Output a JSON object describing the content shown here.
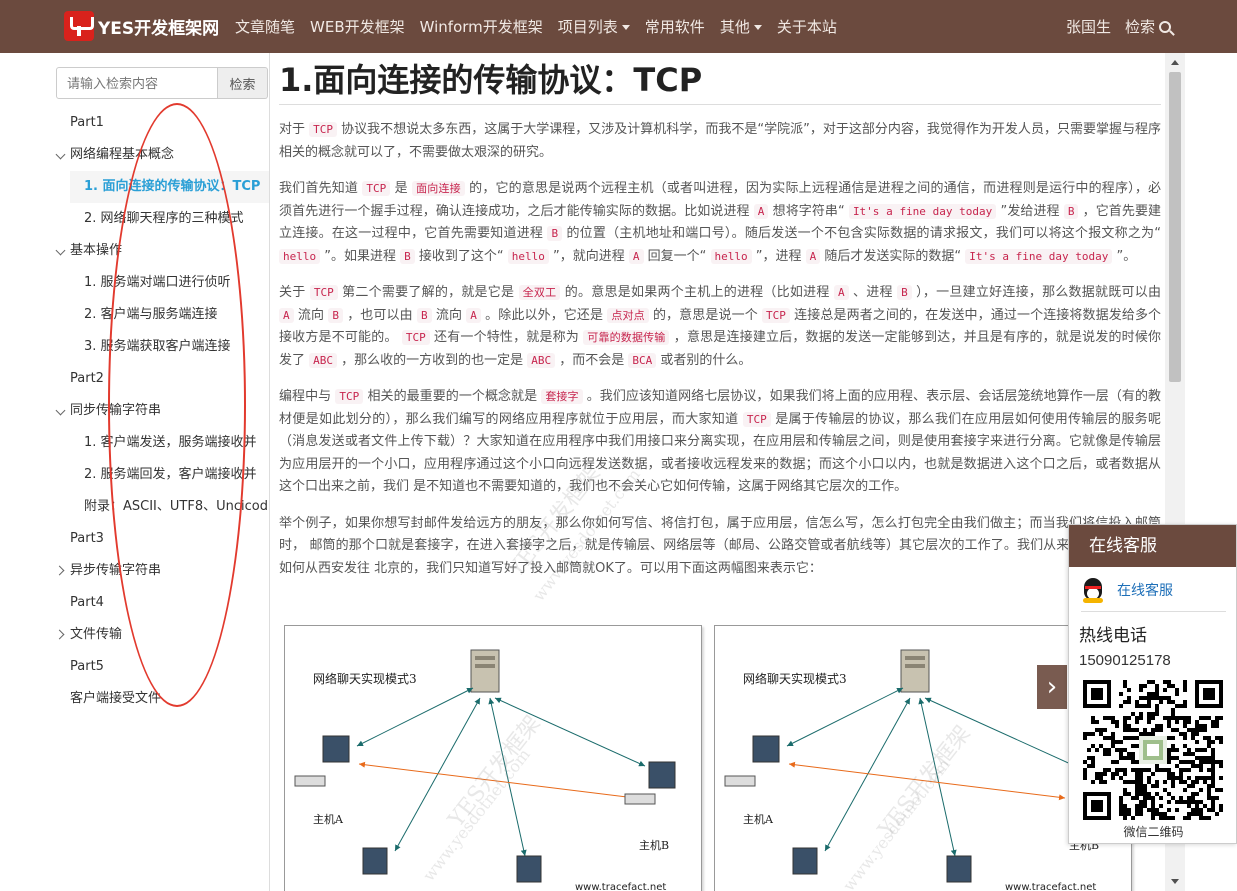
{
  "navbar": {
    "logo_text": "YES开发框架网",
    "items": [
      {
        "label": "文章随笔",
        "dropdown": false
      },
      {
        "label": "WEB开发框架",
        "dropdown": false
      },
      {
        "label": "Winform开发框架",
        "dropdown": false
      },
      {
        "label": "项目列表",
        "dropdown": true
      },
      {
        "label": "常用软件",
        "dropdown": false
      },
      {
        "label": "其他",
        "dropdown": true
      },
      {
        "label": "关于本站",
        "dropdown": false
      }
    ],
    "user": "张国生",
    "search_label": "检索"
  },
  "sidebar": {
    "search_placeholder": "请输入检索内容",
    "search_button": "检索",
    "toc": [
      {
        "label": "Part1",
        "level": 0,
        "toggle": "none"
      },
      {
        "label": "网络编程基本概念",
        "level": 0,
        "toggle": "expanded"
      },
      {
        "label": "1. 面向连接的传输协议：TCP",
        "level": 1,
        "toggle": "none",
        "active": true
      },
      {
        "label": "2. 网络聊天程序的三种模式",
        "level": 1,
        "toggle": "none"
      },
      {
        "label": "基本操作",
        "level": 0,
        "toggle": "expanded"
      },
      {
        "label": "1. 服务端对端口进行侦听",
        "level": 1,
        "toggle": "none"
      },
      {
        "label": "2. 客户端与服务端连接",
        "level": 1,
        "toggle": "none"
      },
      {
        "label": "3. 服务端获取客户端连接",
        "level": 1,
        "toggle": "none"
      },
      {
        "label": "Part2",
        "level": 0,
        "toggle": "none"
      },
      {
        "label": "同步传输字符串",
        "level": 0,
        "toggle": "expanded"
      },
      {
        "label": "1. 客户端发送，服务端接收并",
        "level": 1,
        "toggle": "none"
      },
      {
        "label": "2. 服务端回发，客户端接收并",
        "level": 1,
        "toggle": "none"
      },
      {
        "label": "附录：ASCII、UTF8、Uncicod",
        "level": 1,
        "toggle": "none"
      },
      {
        "label": "Part3",
        "level": 0,
        "toggle": "none"
      },
      {
        "label": "异步传输字符串",
        "level": 0,
        "toggle": "collapsed"
      },
      {
        "label": "Part4",
        "level": 0,
        "toggle": "none"
      },
      {
        "label": "文件传输",
        "level": 0,
        "toggle": "collapsed"
      },
      {
        "label": "Part5",
        "level": 0,
        "toggle": "none"
      },
      {
        "label": "客户端接受文件",
        "level": 0,
        "toggle": "none"
      }
    ]
  },
  "article": {
    "title": "1.面向连接的传输协议：TCP",
    "paragraphs": [
      [
        {
          "t": "对于 "
        },
        {
          "c": "TCP"
        },
        {
          "t": " 协议我不想说太多东西，这属于大学课程，又涉及计算机科学，而我不是“学院派”，对于这部分内容，我觉得作为开发人员，只需要掌握与程序相关的概念就可以了，不需要做太艰深的研究。"
        }
      ],
      [
        {
          "t": "我们首先知道 "
        },
        {
          "c": "TCP"
        },
        {
          "t": " 是 "
        },
        {
          "c": "面向连接"
        },
        {
          "t": " 的，它的意思是说两个远程主机（或者叫进程，因为实际上远程通信是进程之间的通信，而进程则是运行中的程序），必须首先进行一个握手过程，确认连接成功，之后才能传输实际的数据。比如说进程 "
        },
        {
          "c": "A"
        },
        {
          "t": " 想将字符串“ "
        },
        {
          "c": "It's a fine day today"
        },
        {
          "t": " ”发给进程 "
        },
        {
          "c": "B"
        },
        {
          "t": " ，它首先要建立连接。在这一过程中，它首先需要知道进程 "
        },
        {
          "c": "B"
        },
        {
          "t": " 的位置（主机地址和端口号）。随后发送一个不包含实际数据的请求报文，我们可以将这个报文称之为“ "
        },
        {
          "c": "hello"
        },
        {
          "t": " ”。如果进程 "
        },
        {
          "c": "B"
        },
        {
          "t": " 接收到了这个“ "
        },
        {
          "c": "hello"
        },
        {
          "t": " ”，就向进程 "
        },
        {
          "c": "A"
        },
        {
          "t": " 回复一个“ "
        },
        {
          "c": "hello"
        },
        {
          "t": " ”，进程 "
        },
        {
          "c": "A"
        },
        {
          "t": " 随后才发送实际的数据“ "
        },
        {
          "c": "It's a fine day today"
        },
        {
          "t": " ”。"
        }
      ],
      [
        {
          "t": "关于 "
        },
        {
          "c": "TCP"
        },
        {
          "t": " 第二个需要了解的，就是它是 "
        },
        {
          "c": "全双工"
        },
        {
          "t": " 的。意思是如果两个主机上的进程（比如进程 "
        },
        {
          "c": "A"
        },
        {
          "t": " 、进程 "
        },
        {
          "c": "B"
        },
        {
          "t": " ），一旦建立好连接，那么数据就既可以由 "
        },
        {
          "c": "A"
        },
        {
          "t": " 流向 "
        },
        {
          "c": "B"
        },
        {
          "t": " ，也可以由 "
        },
        {
          "c": "B"
        },
        {
          "t": " 流向 "
        },
        {
          "c": "A"
        },
        {
          "t": " 。除此以外，它还是 "
        },
        {
          "c": "点对点"
        },
        {
          "t": " 的，意思是说一个 "
        },
        {
          "c": "TCP"
        },
        {
          "t": " 连接总是两者之间的，在发送中，通过一个连接将数据发给多个接收方是不可能的。 "
        },
        {
          "c": "TCP"
        },
        {
          "t": " 还有一个特性，就是称为 "
        },
        {
          "c": "可靠的数据传输"
        },
        {
          "t": " ，意思是连接建立后，数据的发送一定能够到达，并且是有序的，就是说发的时候你发了 "
        },
        {
          "c": "ABC"
        },
        {
          "t": " ，那么收的一方收到的也一定是 "
        },
        {
          "c": "ABC"
        },
        {
          "t": " ，而不会是 "
        },
        {
          "c": "BCA"
        },
        {
          "t": " 或者别的什么。"
        }
      ],
      [
        {
          "t": "编程中与 "
        },
        {
          "c": "TCP"
        },
        {
          "t": " 相关的最重要的一个概念就是 "
        },
        {
          "c": "套接字"
        },
        {
          "t": " 。我们应该知道网络七层协议，如果我们将上面的应用程、表示层、会话层笼统地算作一层（有的教材便是如此划分的），那么我们编写的网络应用程序就位于应用层，而大家知道 "
        },
        {
          "c": "TCP"
        },
        {
          "t": " 是属于传输层的协议，那么我们在应用层如何使用传输层的服务呢（消息发送或者文件上传下载）？大家知道在应用程序中我们用接口来分离实现，在应用层和传输层之间，则是使用套接字来进行分离。它就像是传输层为应用层开的一个小口，应用程序通过这个小口向远程发送数据，或者接收远程发来的数据；而这个小口以内，也就是数据进入这个口之后，或者数据从这个口出来之前，我们 是不知道也不需要知道的，我们也不会关心它如何传输，这属于网络其它层次的工作。"
        }
      ],
      [
        {
          "t": "举个例子，如果你想写封邮件发给远方的朋友，那么你如何写信、将信打包，属于应用层，信怎么写，怎么打包完全由我们做主；而当我们将信投入邮筒时， 邮筒的那个口就是套接字，在进入套接字之后，就是传输层、网络层等（邮局、公路交管或者航线等）其它层次的工作了。我们从来不会去关心信是如何从西安发往 北京的，我们只知道写好了投入邮筒就OK了。可以用下面这两幅图来表示它："
        }
      ]
    ],
    "figures": [
      {
        "title": "网络聊天实现模式3",
        "host_a": "主机A",
        "host_b": "主机B",
        "url": "www.tracefact.net"
      },
      {
        "title": "网络聊天实现模式3",
        "host_a": "主机A",
        "host_b": "主机B",
        "url": "www.tracefact.net"
      }
    ],
    "watermark_lines": [
      "YES开发框架",
      "www.yesdotnet.com"
    ]
  },
  "service": {
    "title": "在线客服",
    "qq_link": "在线客服",
    "hotline_label": "热线电话",
    "hotline_number": "15090125178",
    "qr_caption": "微信二维码"
  },
  "colors": {
    "brand": "#6b4a3e",
    "active_link": "#2a9fd6",
    "code_text": "#c7254e",
    "annotation": "#e23a2e"
  }
}
